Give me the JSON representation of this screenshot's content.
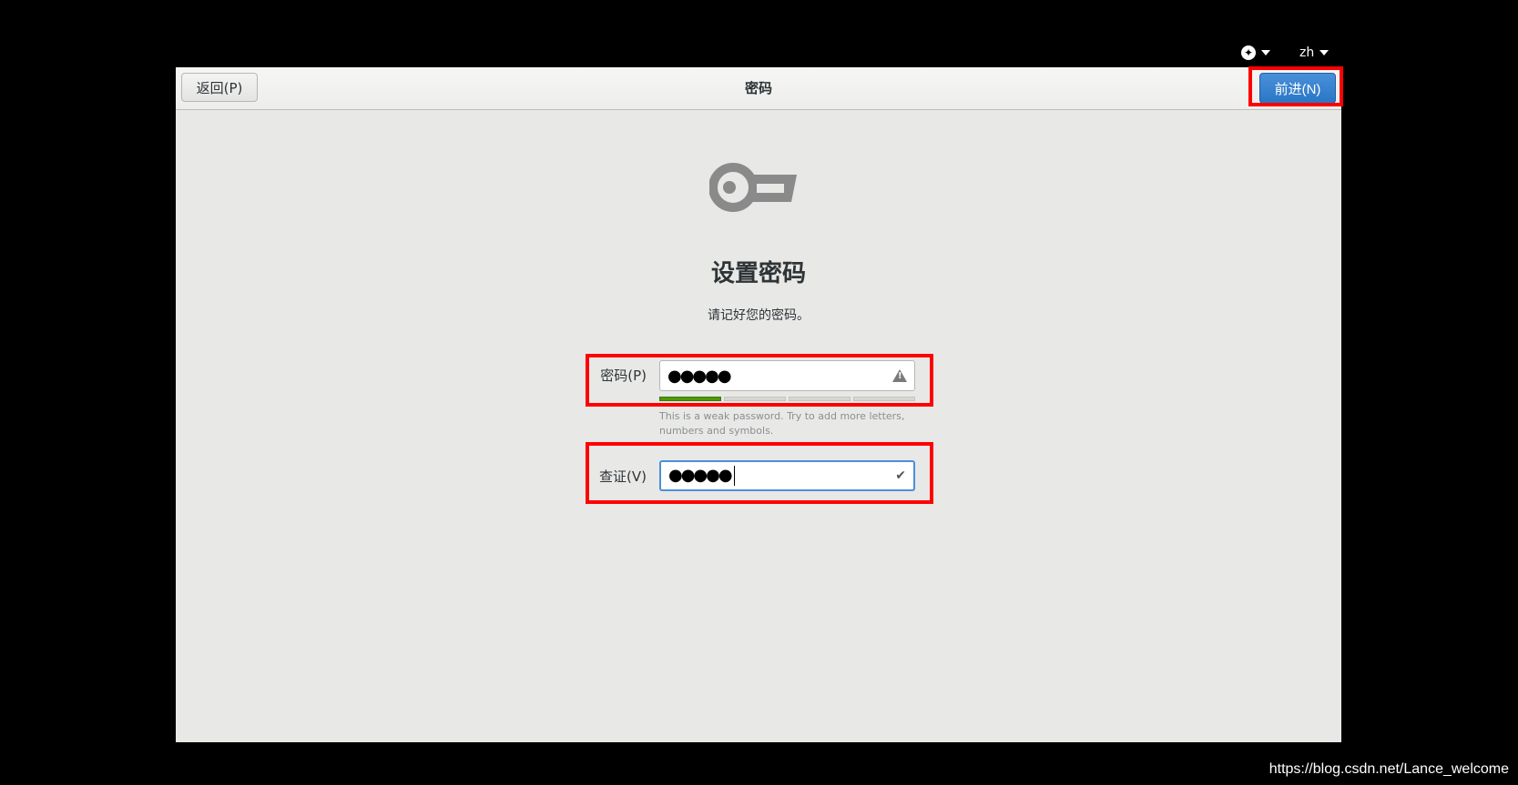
{
  "topbar": {
    "accessibility_icon": "accessibility-icon",
    "language": "zh"
  },
  "header": {
    "back_label": "返回(P)",
    "title": "密码",
    "next_label": "前进(N)"
  },
  "main": {
    "icon": "key-icon",
    "heading": "设置密码",
    "subtext": "请记好您的密码。",
    "password": {
      "label": "密码(P)",
      "value": "●●●●●",
      "status_icon": "warning-icon",
      "strength_segments_filled": 1,
      "strength_segments_total": 4,
      "hint": "This is a weak password. Try to add more letters, numbers and symbols."
    },
    "confirm": {
      "label": "查证(V)",
      "value": "●●●●●",
      "status_icon": "check-icon"
    }
  },
  "colors": {
    "accent": "#4a90d9",
    "highlight": "#ff0000",
    "strength_fill": "#4e9a06"
  },
  "watermark": "https://blog.csdn.net/Lance_welcome"
}
